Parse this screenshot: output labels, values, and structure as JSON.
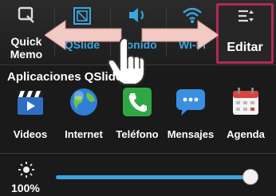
{
  "quick_settings": [
    {
      "label_lines": [
        "Quick",
        "Memo"
      ],
      "icon": "quick-memo-icon"
    },
    {
      "label_lines": [
        "QSlide"
      ],
      "icon": "qslide-icon"
    },
    {
      "label_lines": [
        "Sonido"
      ],
      "icon": "speaker-icon"
    },
    {
      "label_lines": [
        "Wi-Fi"
      ],
      "icon": "wifi-icon"
    },
    {
      "label_lines": [
        "Editar"
      ],
      "icon": "edit-sliders-icon"
    }
  ],
  "apps_section_title": "Aplicaciones QSlide",
  "apps": [
    {
      "label": "Videos",
      "icon": "clapperboard-icon"
    },
    {
      "label": "Internet",
      "icon": "globe-icon"
    },
    {
      "label": "Teléfono",
      "icon": "phone-icon"
    },
    {
      "label": "Mensajes",
      "icon": "message-bubble-icon"
    },
    {
      "label": "Agenda",
      "icon": "calendar-icon"
    }
  ],
  "brightness": {
    "percent_label": "100%",
    "level": 1.0
  },
  "colors": {
    "accent": "#3aa6e0",
    "highlight_border": "#b02a5a",
    "arrow": "#f3c9c3"
  }
}
